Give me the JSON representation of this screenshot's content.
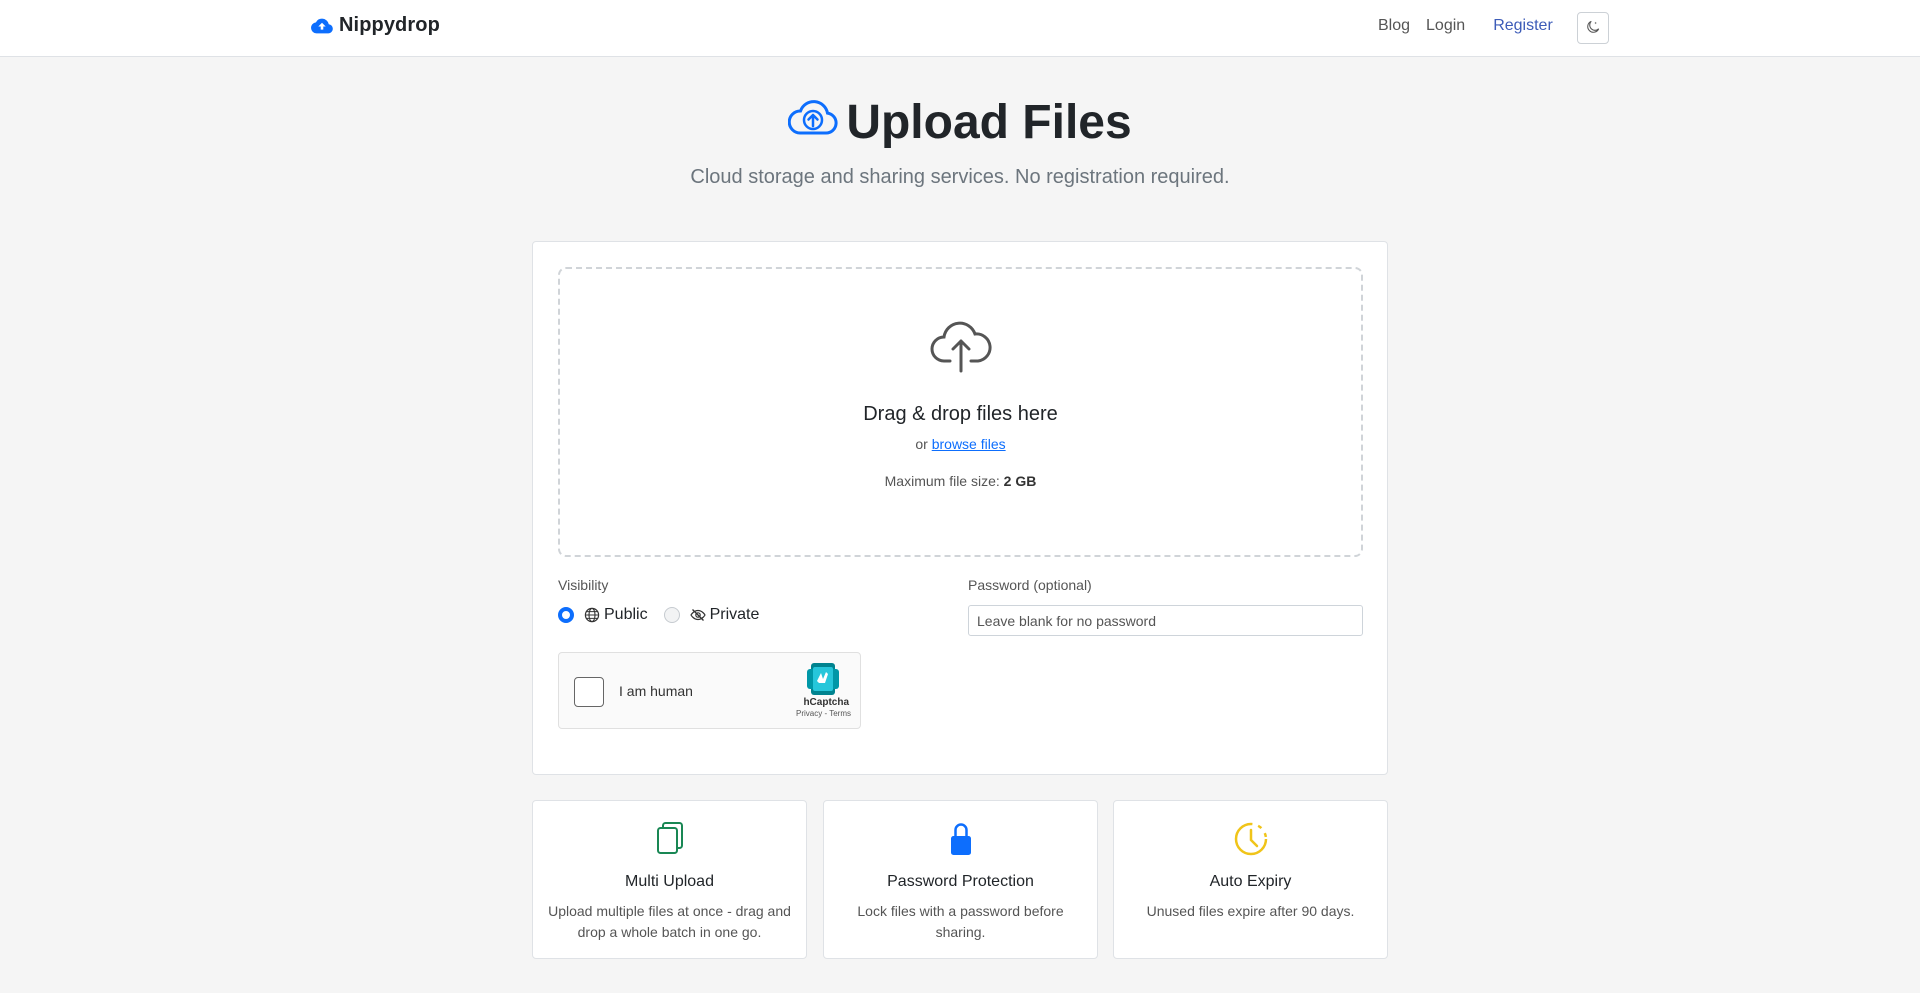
{
  "nav": {
    "brand": "Nippydrop",
    "links": {
      "blog": "Blog",
      "login": "Login",
      "register": "Register"
    },
    "theme_icon": "moon-icon"
  },
  "hero": {
    "title": "Upload Files",
    "subtitle": "Cloud storage and sharing services. No registration required.",
    "icon": "cloud-upload-icon"
  },
  "dropzone": {
    "title": "Drag & drop files here",
    "or": "or",
    "browse": "browse files",
    "max_label": "Maximum file size:",
    "max_value": "2 GB"
  },
  "form": {
    "visibility_label": "Visibility",
    "public": "Public",
    "private": "Private",
    "selected": "Public",
    "password_label": "Password (optional)",
    "password_placeholder": "Leave blank for no password",
    "password_value": ""
  },
  "captcha": {
    "label": "I am human",
    "brand": "hCaptcha",
    "links": "Privacy - Terms"
  },
  "features": [
    {
      "title": "Multi Upload",
      "desc": "Upload multiple files at once - drag and drop a whole batch in one go.",
      "icon": "files-icon",
      "color": "#198754"
    },
    {
      "title": "Password Protection",
      "desc": "Lock files with a password before sharing.",
      "icon": "lock-icon",
      "color": "#0d6efd"
    },
    {
      "title": "Auto Expiry",
      "desc": "Unused files expire after 90 days.",
      "icon": "clock-icon",
      "color": "#f0c419"
    }
  ],
  "colors": {
    "accent": "#0d6efd",
    "register_link": "#3d5cb8",
    "background": "#f5f5f5"
  }
}
